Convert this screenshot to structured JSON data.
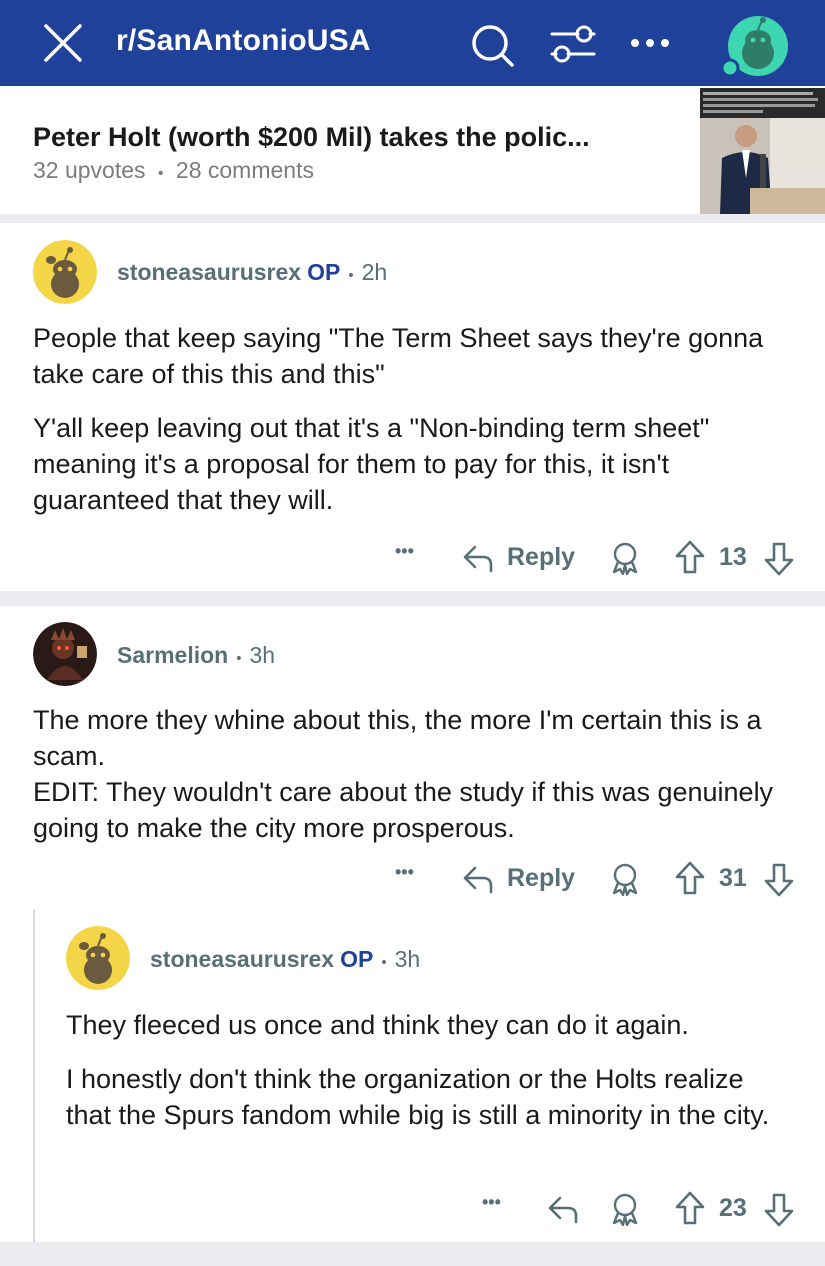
{
  "header": {
    "subreddit": "r/SanAntonioUSA",
    "icons": [
      "close-icon",
      "search-icon",
      "filter-icon",
      "more-icon",
      "avatar-icon"
    ],
    "accent": "#1f419a"
  },
  "post": {
    "title": "Peter Holt (worth $200 Mil) takes the polic...",
    "upvotes": "32 upvotes",
    "dot": "•",
    "comments": "28 comments"
  },
  "comments": [
    {
      "username": "stoneasaurusrex",
      "op": "OP",
      "dot": "•",
      "time": "2h",
      "paragraphs": [
        "People that keep saying \"The Term Sheet says they're gonna take care of this this and this\"",
        "Y'all keep leaving out that it's a \"Non-binding term sheet\" meaning it's a proposal for them to pay for this, it isn't guaranteed that they will."
      ],
      "more": "•••",
      "reply": "Reply",
      "votes": "13"
    },
    {
      "username": "Sarmelion",
      "dot": "•",
      "time": "3h",
      "paragraphs": [
        "The more they whine about this, the more I'm certain this is a scam.\nEDIT: They wouldn't care about the study if this was genuinely going to make the city more prosperous."
      ],
      "more": "•••",
      "reply": "Reply",
      "votes": "31"
    },
    {
      "username": "stoneasaurusrex",
      "op": "OP",
      "dot": "•",
      "time": "3h",
      "paragraphs": [
        "They fleeced us once and think they can do it again.",
        "I honestly don't think the organization or the Holts realize that the Spurs fandom while big is still a minority in the city."
      ],
      "more": "•••",
      "votes": "23"
    }
  ]
}
